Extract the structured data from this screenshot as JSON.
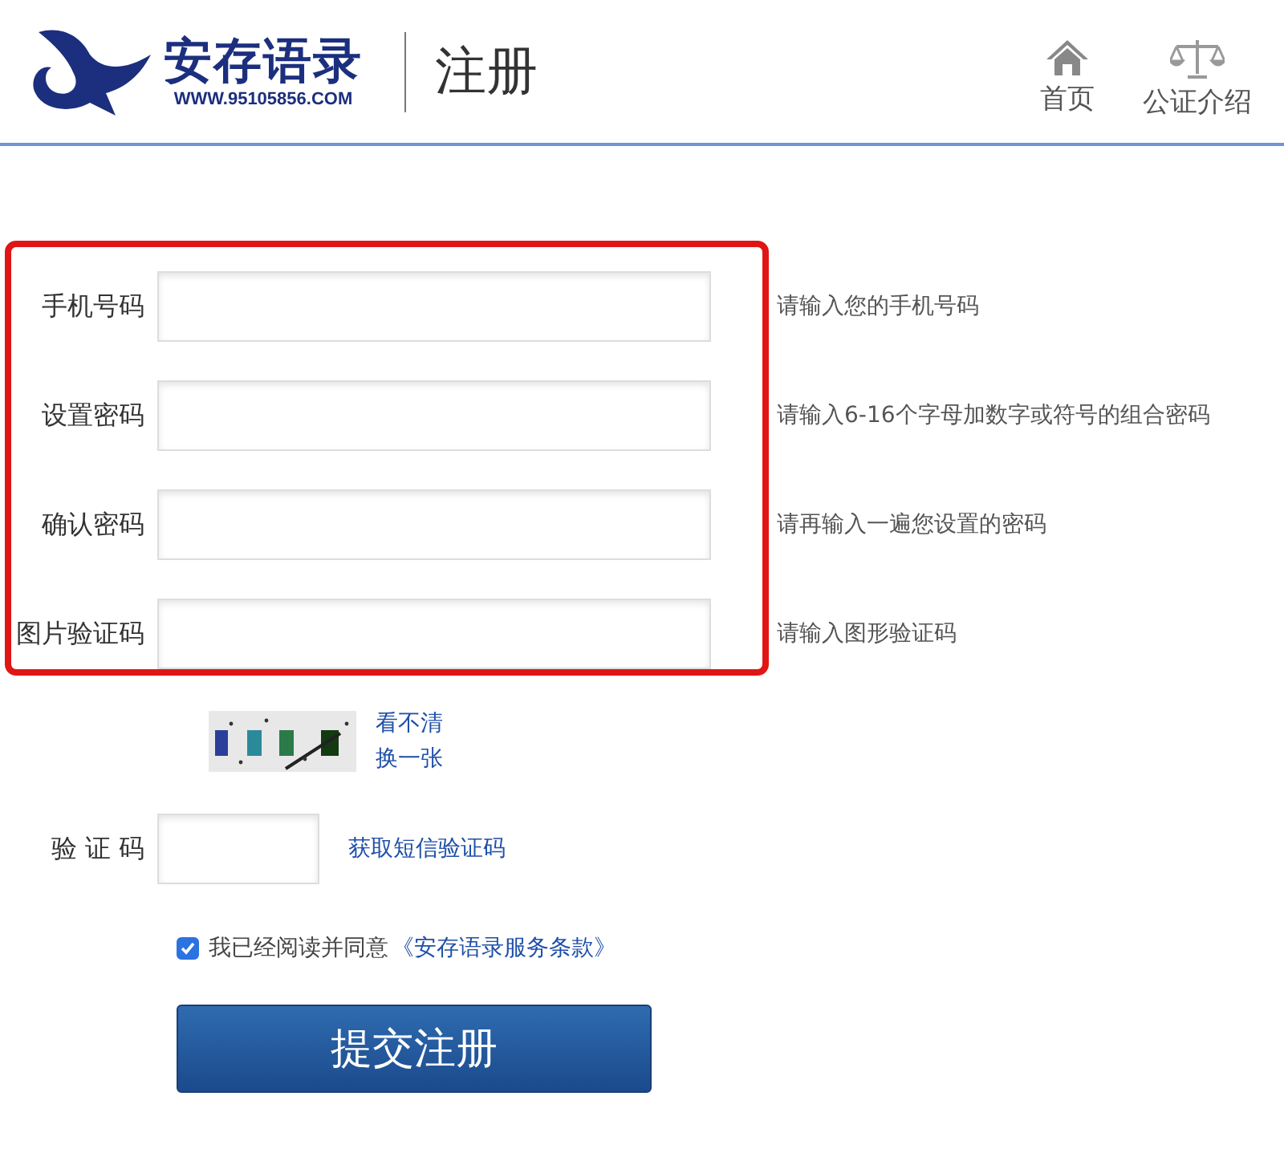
{
  "header": {
    "logo": {
      "name": "安存语录",
      "url": "WWW.95105856.COM"
    },
    "page_title": "注册",
    "nav": [
      {
        "kind": "home",
        "label": "首页"
      },
      {
        "kind": "scales",
        "label": "公证介绍"
      }
    ]
  },
  "fields": [
    {
      "label": "手机号码",
      "hint": "请输入您的手机号码"
    },
    {
      "label": "设置密码",
      "hint": "请输入6-16个字母加数字或符号的组合密码"
    },
    {
      "label": "确认密码",
      "hint": "请再输入一遍您设置的密码"
    },
    {
      "label": "图片验证码",
      "hint": "请输入图形验证码"
    }
  ],
  "captcha": {
    "links": [
      "看不清",
      "换一张"
    ]
  },
  "sms": {
    "label": "验 证 码",
    "link": "获取短信验证码"
  },
  "agreement": {
    "checked": true,
    "text": "我已经阅读并同意",
    "link": "《安存语录服务条款》"
  },
  "submit": "提交注册"
}
